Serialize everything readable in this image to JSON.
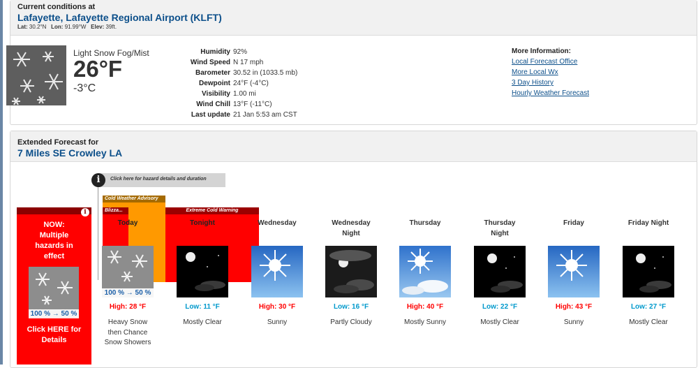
{
  "current": {
    "heading": "Current conditions at",
    "station": "Lafayette, Lafayette Regional Airport (KLFT)",
    "lat_label": "Lat:",
    "lat": "30.2°N",
    "lon_label": "Lon:",
    "lon": "91.99°W",
    "elev_label": "Elev:",
    "elev": "39ft.",
    "condition": "Light Snow Fog/Mist",
    "temp_f": "26°F",
    "temp_c": "-3°C",
    "icon": "snow-icon",
    "details": [
      {
        "label": "Humidity",
        "value": "92%"
      },
      {
        "label": "Wind Speed",
        "value": "N 17 mph"
      },
      {
        "label": "Barometer",
        "value": "30.52 in (1033.5 mb)"
      },
      {
        "label": "Dewpoint",
        "value": "24°F (-4°C)"
      },
      {
        "label": "Visibility",
        "value": "1.00 mi"
      },
      {
        "label": "Wind Chill",
        "value": "13°F (-11°C)"
      },
      {
        "label": "Last update",
        "value": "21 Jan 5:53 am CST"
      }
    ],
    "more_info": {
      "title": "More Information:",
      "links": [
        "Local Forecast Office",
        "More Local Wx",
        "3 Day History",
        "Hourly Weather Forecast"
      ]
    }
  },
  "extended": {
    "heading": "Extended Forecast for",
    "location": "7 Miles SE Crowley LA",
    "hazard_tip": "Click here for hazard details and duration",
    "now": {
      "text_lines": [
        "NOW:",
        "Multiple",
        "hazards in",
        "effect"
      ],
      "pct": "100 % → 50 %",
      "click_lines": [
        "Click HERE for",
        "Details"
      ]
    },
    "advisories": {
      "cold": "Cold Weather Advisory",
      "blizzard": "Blizza...",
      "extreme": "Extreme Cold Warning"
    },
    "periods": [
      {
        "name": [
          "Today"
        ],
        "icon": "snow-icon",
        "pct": "100 % → 50 %",
        "temp": "High: 28 °F",
        "kind": "high",
        "short": [
          "Heavy Snow",
          "then Chance",
          "Snow Showers"
        ]
      },
      {
        "name": [
          "Tonight"
        ],
        "icon": "night-clear-icon",
        "pct": "",
        "temp": "Low: 11 °F",
        "kind": "low",
        "short": [
          "Mostly Clear"
        ]
      },
      {
        "name": [
          "Wednesday"
        ],
        "icon": "sunny-icon",
        "pct": "",
        "temp": "High: 30 °F",
        "kind": "high",
        "short": [
          "Sunny"
        ]
      },
      {
        "name": [
          "Wednesday",
          "Night"
        ],
        "icon": "partly-cloudy-night-icon",
        "pct": "",
        "temp": "Low: 16 °F",
        "kind": "low",
        "short": [
          "Partly Cloudy"
        ]
      },
      {
        "name": [
          "Thursday"
        ],
        "icon": "mostly-sunny-icon",
        "pct": "",
        "temp": "High: 40 °F",
        "kind": "high",
        "short": [
          "Mostly Sunny"
        ]
      },
      {
        "name": [
          "Thursday",
          "Night"
        ],
        "icon": "night-clear-icon",
        "pct": "",
        "temp": "Low: 22 °F",
        "kind": "low",
        "short": [
          "Mostly Clear"
        ]
      },
      {
        "name": [
          "Friday"
        ],
        "icon": "sunny-icon",
        "pct": "",
        "temp": "High: 43 °F",
        "kind": "high",
        "short": [
          "Sunny"
        ]
      },
      {
        "name": [
          "Friday Night"
        ],
        "icon": "night-clear-icon",
        "pct": "",
        "temp": "Low: 27 °F",
        "kind": "low",
        "short": [
          "Mostly Clear"
        ]
      }
    ]
  },
  "colors": {
    "high": "#ff0000",
    "low": "#0099cc",
    "link": "#0c4f8a",
    "hazard_red": "#ff0000",
    "advisory_orange": "#ff9900"
  }
}
